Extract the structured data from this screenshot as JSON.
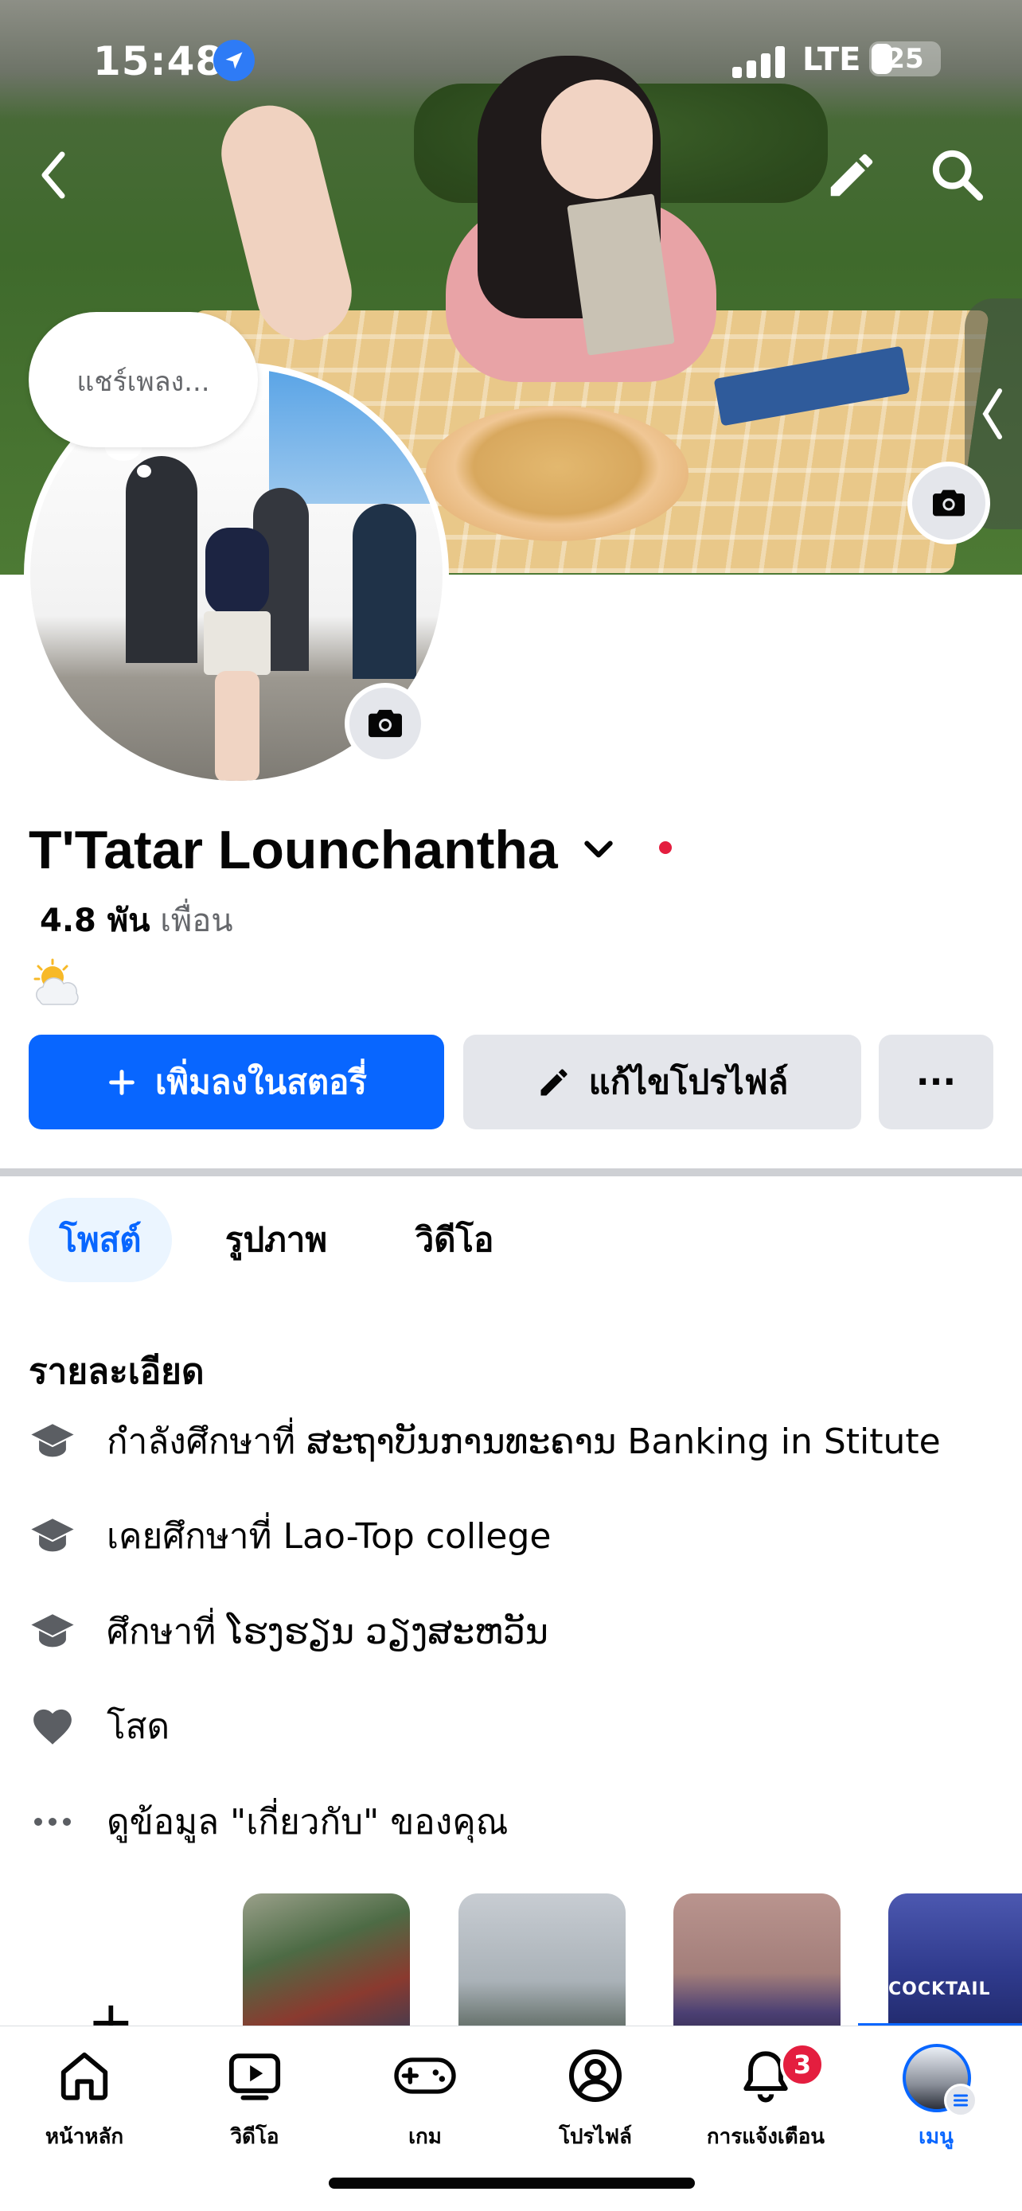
{
  "status_bar": {
    "time": "15:48",
    "network": "LTE",
    "battery": "25"
  },
  "cover": {
    "photo": "cover-photo",
    "edit_icon": "pencil-icon",
    "search_icon": "search-icon",
    "camera_icon": "camera-icon"
  },
  "thought_bubble": {
    "text": "แชร์เพลง..."
  },
  "profile": {
    "name": "T'Tatar Lounchantha",
    "friends_count": "4.8 พัน",
    "friends_label": "เพื่อน"
  },
  "actions": {
    "add_story": "เพิ่มลงในสตอรี่",
    "edit_profile": "แก้ไขโปรไฟล์",
    "more": "···"
  },
  "tabs": [
    {
      "label": "โพสต์",
      "active": true
    },
    {
      "label": "รูปภาพ"
    },
    {
      "label": "วิดีโอ"
    }
  ],
  "details": {
    "title": "รายละเอียด",
    "items": [
      {
        "icon": "education-icon",
        "text": "กำลังศึกษาที่ ສະຖາບັນການທະຄານ Banking in Stitute"
      },
      {
        "icon": "education-icon",
        "text": "เคยศึกษาที่ Lao-Top college"
      },
      {
        "icon": "education-icon",
        "text": "ศึกษาที่ ໂຮງຮຽນ ວຽງສະຫວັນ"
      },
      {
        "icon": "heart-icon",
        "text": "โสด"
      },
      {
        "icon": "more-dots-icon",
        "text": "ดูข้อมูล \"เกี่ยวกับ\" ของคุณ"
      }
    ]
  },
  "featured": {
    "add_label": "+",
    "thumb4_label": "COCKTAIL"
  },
  "bottom_nav": {
    "items": [
      {
        "label": "หน้าหลัก",
        "icon": "home-icon"
      },
      {
        "label": "วิดีโอ",
        "icon": "video-icon"
      },
      {
        "label": "เกม",
        "icon": "gamepad-icon"
      },
      {
        "label": "โปรไฟล์",
        "icon": "profile-icon"
      },
      {
        "label": "การแจ้งเตือน",
        "icon": "bell-icon",
        "badge": "3"
      },
      {
        "label": "เมนู",
        "icon": "menu-avatar",
        "active": true
      }
    ]
  },
  "colors": {
    "accent": "#0866ff",
    "badge": "#e41e3f",
    "secondary_button": "#e4e6eb",
    "tab_active_bg": "#ebf5ff"
  }
}
